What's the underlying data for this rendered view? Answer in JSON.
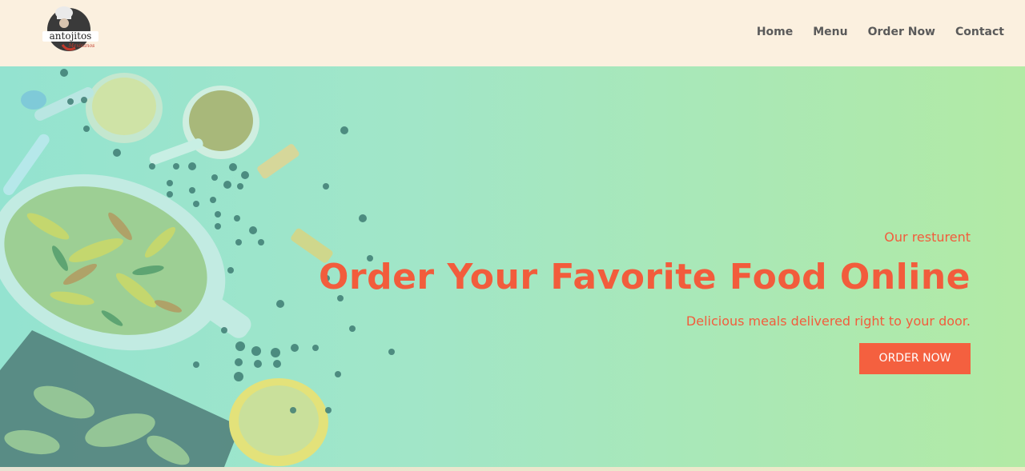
{
  "header": {
    "logo": {
      "text": "antojitos",
      "subtext": "Mexicanos",
      "icon": "chef-hat-logo"
    },
    "nav": [
      {
        "label": "Home"
      },
      {
        "label": "Menu"
      },
      {
        "label": "Order Now"
      },
      {
        "label": "Contact"
      }
    ]
  },
  "hero": {
    "eyebrow": "Our resturent",
    "title": "Order Your Favorite Food Online",
    "subtitle": "Delicious meals delivered right to your door.",
    "cta_label": "ORDER NOW",
    "image": "food-spread-illustration"
  },
  "colors": {
    "accent": "#f25c3c",
    "nav_bg": "#fbf0df",
    "nav_text": "#5a5a5a",
    "hero_gradient_start": "#94e3d0",
    "hero_gradient_end": "#b2eaa5"
  }
}
